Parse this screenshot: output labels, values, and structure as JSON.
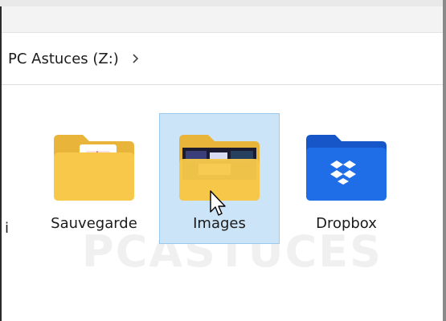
{
  "address": {
    "breadcrumb": "PC Astuces (Z:)"
  },
  "folders": [
    {
      "label": "Sauvegarde",
      "icon": "folder-pdf-icon",
      "selected": false
    },
    {
      "label": "Images",
      "icon": "folder-images-icon",
      "selected": true
    },
    {
      "label": "Dropbox",
      "icon": "dropbox-folder-icon",
      "selected": false
    }
  ],
  "colors": {
    "selection_bg": "#cce4f7",
    "selection_border": "#99c9ef",
    "folder_yellow": "#f7c84a",
    "dropbox_blue": "#1f6ee8"
  }
}
